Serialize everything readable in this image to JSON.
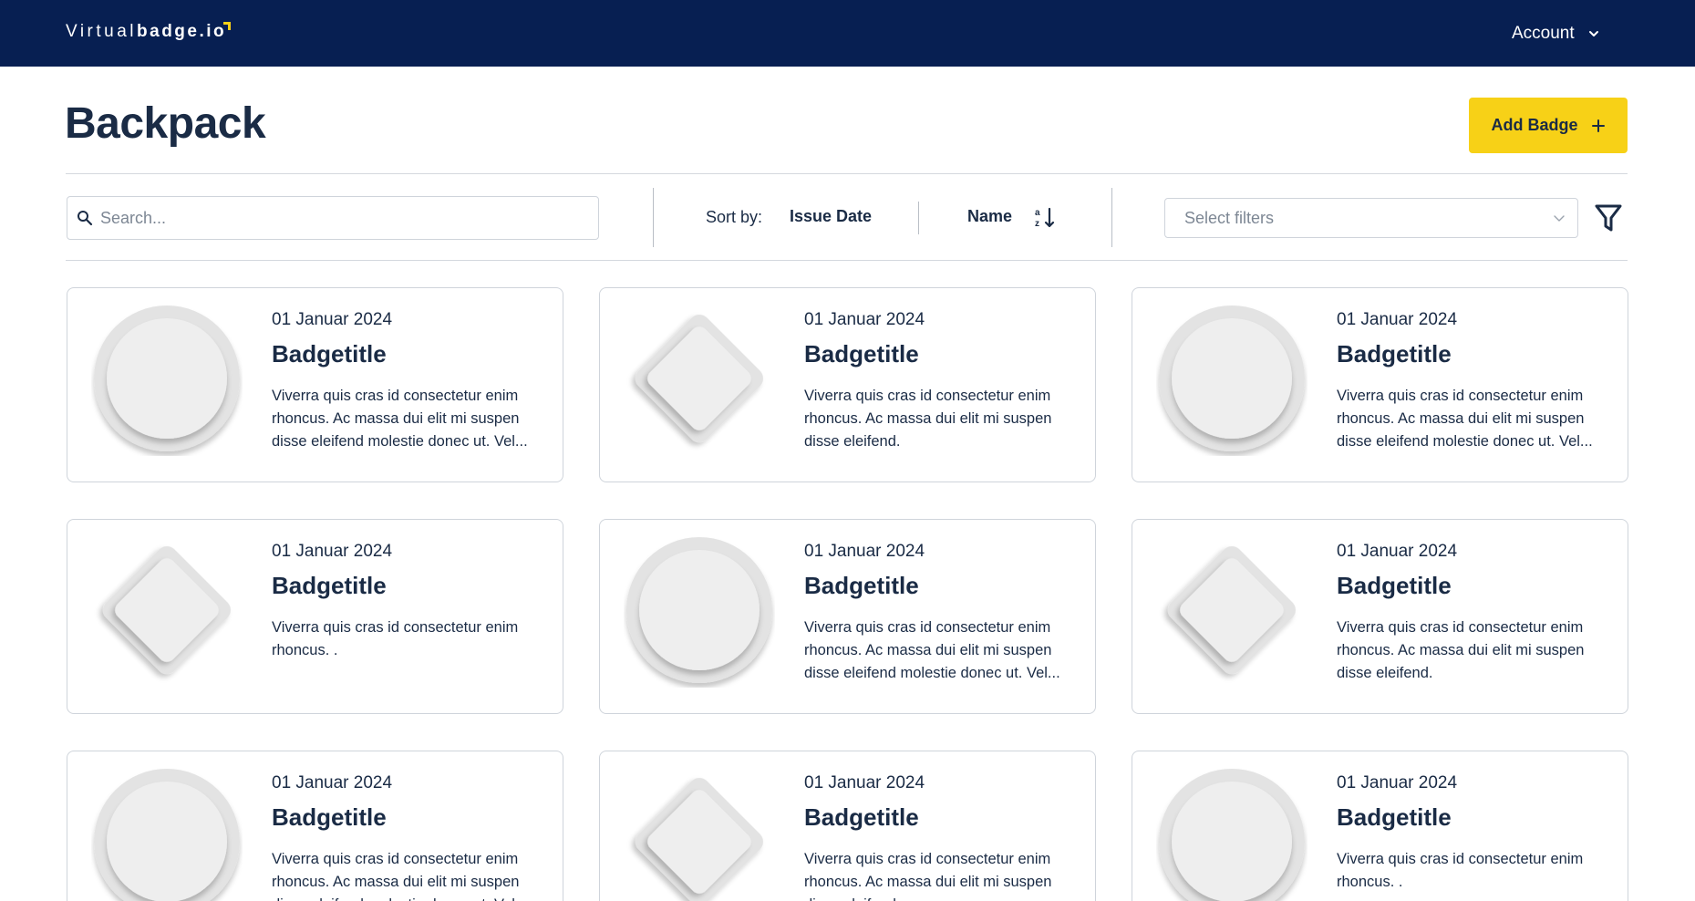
{
  "header": {
    "logo_light": "Virtual",
    "logo_bold": "badge.io",
    "account_label": "Account"
  },
  "page": {
    "title": "Backpack",
    "add_badge_label": "Add Badge"
  },
  "toolbar": {
    "search_placeholder": "Search...",
    "sort_label": "Sort by:",
    "sort_options": [
      "Issue Date",
      "Name"
    ],
    "filter_placeholder": "Select filters"
  },
  "cards": [
    {
      "shape": "circle",
      "date": "01 Januar 2024",
      "title": "Badgetitle",
      "description": "Viverra quis cras id consectetur enim rhoncus. Ac massa dui elit mi suspen disse eleifend molestie donec ut. Vel..."
    },
    {
      "shape": "diamond",
      "date": "01 Januar 2024",
      "title": "Badgetitle",
      "description": "Viverra quis cras id consectetur enim rhoncus. Ac massa dui elit mi suspen disse eleifend."
    },
    {
      "shape": "circle",
      "date": "01 Januar 2024",
      "title": "Badgetitle",
      "description": "Viverra quis cras id consectetur enim rhoncus. Ac massa dui elit mi suspen disse eleifend molestie donec ut. Vel..."
    },
    {
      "shape": "diamond",
      "date": "01 Januar 2024",
      "title": "Badgetitle",
      "description": "Viverra quis cras id consectetur enim rhoncus. ."
    },
    {
      "shape": "circle",
      "date": "01 Januar 2024",
      "title": "Badgetitle",
      "description": "Viverra quis cras id consectetur enim rhoncus. Ac massa dui elit mi suspen disse eleifend molestie donec ut. Vel..."
    },
    {
      "shape": "diamond",
      "date": "01 Januar 2024",
      "title": "Badgetitle",
      "description": "Viverra quis cras id consectetur enim rhoncus. Ac massa dui elit mi suspen disse eleifend."
    },
    {
      "shape": "circle",
      "date": "01 Januar 2024",
      "title": "Badgetitle",
      "description": "Viverra quis cras id consectetur enim rhoncus. Ac massa dui elit mi suspen disse eleifend molestie donec ut. Vel..."
    },
    {
      "shape": "diamond",
      "date": "01 Januar 2024",
      "title": "Badgetitle",
      "description": "Viverra quis cras id consectetur enim rhoncus. Ac massa dui elit mi suspen disse eleifend."
    },
    {
      "shape": "circle",
      "date": "01 Januar 2024",
      "title": "Badgetitle",
      "description": "Viverra quis cras id consectetur enim rhoncus. ."
    }
  ],
  "colors": {
    "header_bg": "#071f52",
    "accent": "#f7d117",
    "text": "#1a2b45",
    "border": "#cfd4db",
    "badge_placeholder": "#e4e4e4"
  }
}
